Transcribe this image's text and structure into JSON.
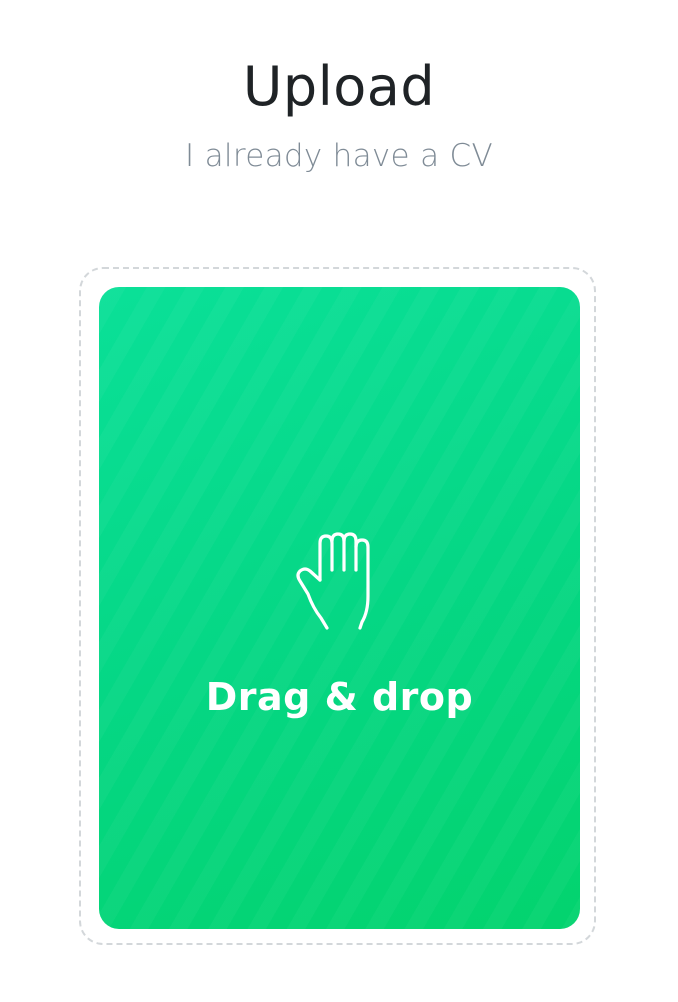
{
  "header": {
    "title": "Upload",
    "subtitle": "I already have a CV"
  },
  "dropzone": {
    "icon": "hand-icon",
    "label": "Drag & drop",
    "color": "#06d889"
  }
}
